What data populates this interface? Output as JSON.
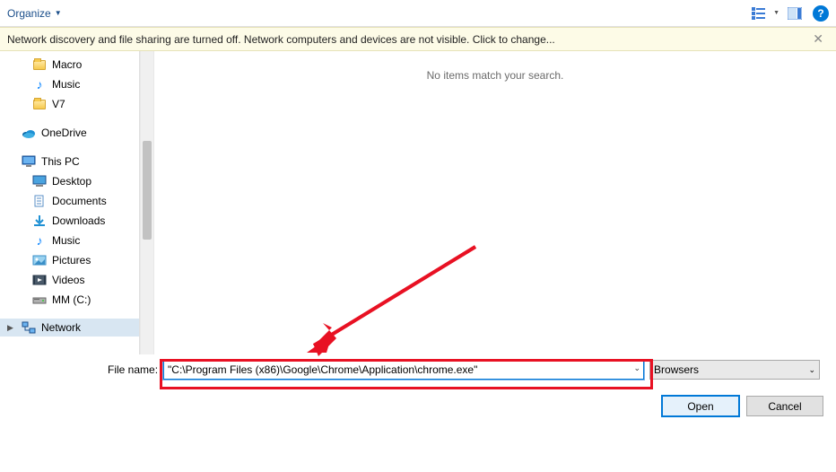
{
  "toolbar": {
    "organize": "Organize"
  },
  "notice": {
    "text": "Network discovery and file sharing are turned off. Network computers and devices are not visible. Click to change...",
    "close": "✕"
  },
  "tree": {
    "macro": "Macro",
    "music1": "Music",
    "v7": "V7",
    "onedrive": "OneDrive",
    "thispc": "This PC",
    "desktop": "Desktop",
    "documents": "Documents",
    "downloads": "Downloads",
    "music2": "Music",
    "pictures": "Pictures",
    "videos": "Videos",
    "drive": "MM (C:)",
    "network": "Network"
  },
  "main": {
    "empty": "No items match your search."
  },
  "bottom": {
    "label": "File name:",
    "value": "\"C:\\Program Files (x86)\\Google\\Chrome\\Application\\chrome.exe\"",
    "filter": "Browsers",
    "open": "Open",
    "cancel": "Cancel"
  }
}
